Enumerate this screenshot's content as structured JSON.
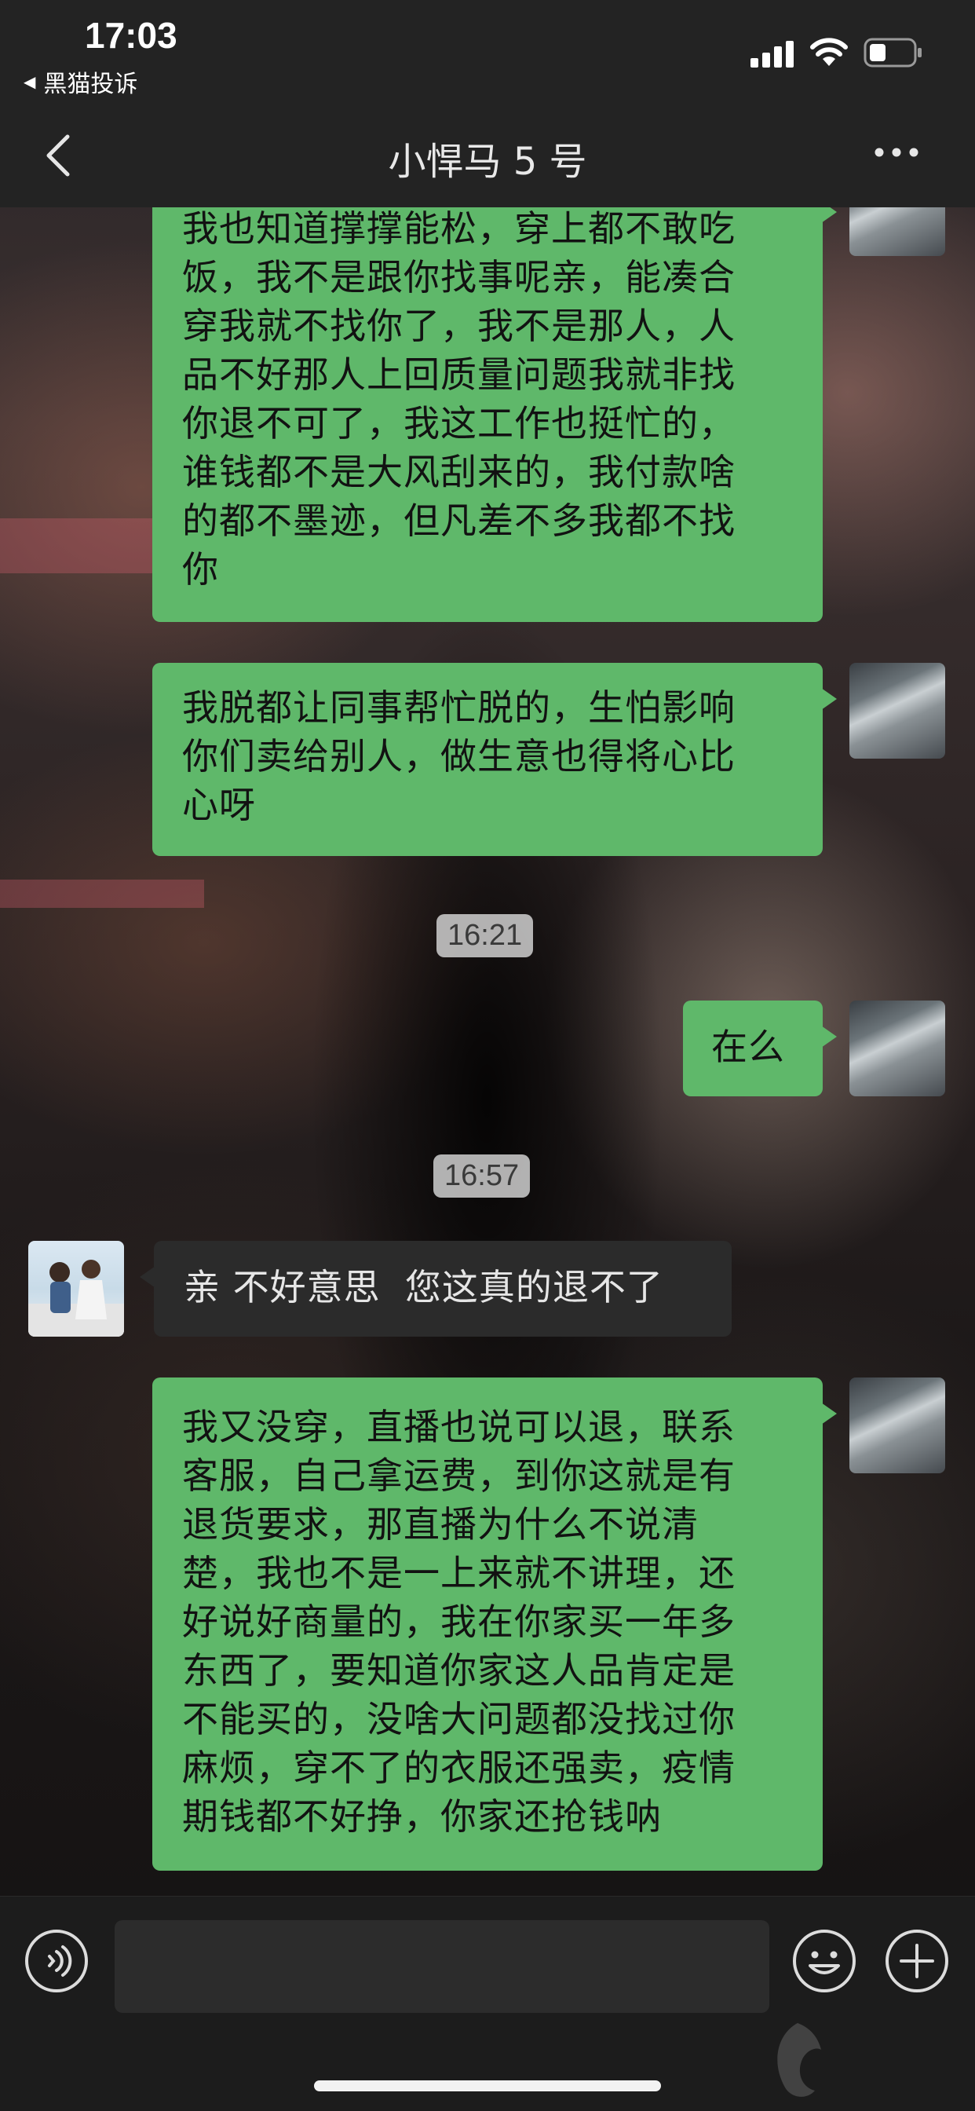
{
  "status_bar": {
    "time": "17:03",
    "back_app_label": "黑猫投诉"
  },
  "nav": {
    "title": "小悍马 5 号"
  },
  "messages": [
    {
      "sender": "me",
      "lines": [
        "我也知道撑撑能松，穿上都不敢吃",
        "饭，我不是跟你找事呢亲，能凑合",
        "穿我就不找你了，我不是那人，人",
        "品不好那人上回质量问题我就非找",
        "你退不可了，我这工作也挺忙的，",
        "谁钱都不是大风刮来的，我付款啥",
        "的都不墨迹，但凡差不多我都不找",
        "你"
      ]
    },
    {
      "sender": "me",
      "lines": [
        "我脱都让同事帮忙脱的，生怕影响",
        "你们卖给别人，做生意也得将心比",
        "心呀"
      ]
    },
    {
      "timestamp": "16:21"
    },
    {
      "sender": "me",
      "lines": [
        "在么"
      ]
    },
    {
      "timestamp": "16:57"
    },
    {
      "sender": "them",
      "lines": [
        "亲 不好意思  您这真的退不了"
      ]
    },
    {
      "sender": "me",
      "lines": [
        "我又没穿，直播也说可以退，联系",
        "客服，自己拿运费，到你这就是有",
        "退货要求，那直播为什么不说清",
        "楚，我也不是一上来就不讲理，还",
        "好说好商量的，我在你家买一年多",
        "东西了，要知道你家这人品肯定是",
        "不能买的，没啥大问题都没找过你",
        "麻烦，穿不了的衣服还强卖，疫情",
        "期钱都不好挣，你家还抢钱呐"
      ]
    }
  ],
  "input_bar": {
    "placeholder": ""
  },
  "colors": {
    "my_bubble": "#5fb86a",
    "their_bubble": "#2b2b2b",
    "bar_background": "#232323"
  },
  "icons": [
    "signal-icon",
    "wifi-icon",
    "battery-icon",
    "back-chevron-icon",
    "more-icon",
    "voice-icon",
    "emoji-icon",
    "plus-icon"
  ]
}
